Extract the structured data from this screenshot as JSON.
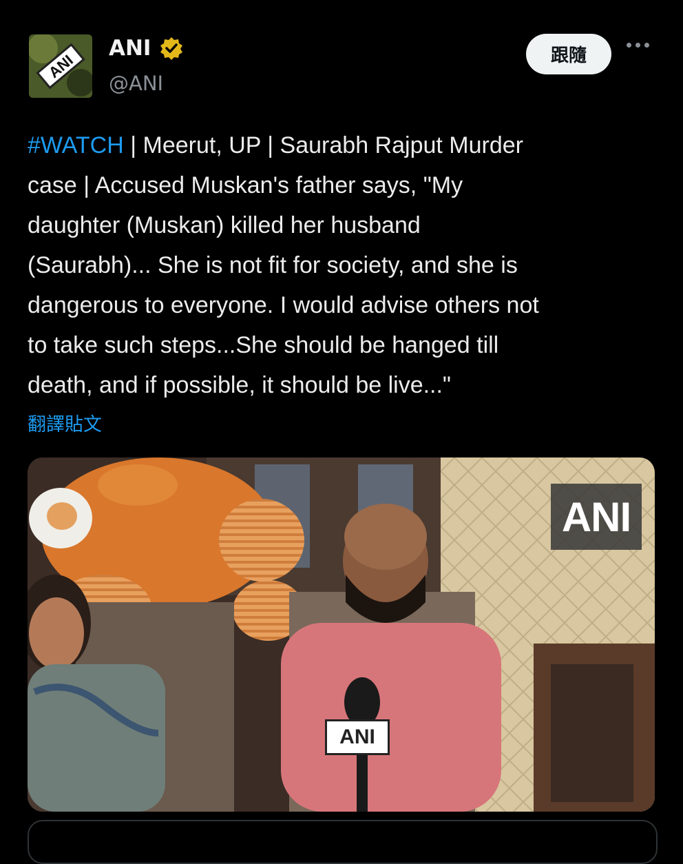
{
  "account": {
    "name": "ANI",
    "handle": "@ANI",
    "avatar_icon": "ani-logo-icon",
    "verified_badge": "verified-badge-icon",
    "verified_color": "#e2b719"
  },
  "actions": {
    "follow_label": "跟隨",
    "more_icon": "more-options-icon"
  },
  "post": {
    "hashtag": "#WATCH",
    "body": " | Meerut, UP | Saurabh Rajput Murder\ncase | Accused Muskan's father says, \"My\ndaughter (Muskan) killed her husband\n(Saurabh)... She is not fit for society, and she is\ndangerous to everyone. I would advise others not\nto take such steps...She should be hanged till\ndeath, and if possible, it should be live...\"",
    "translate_label": "翻譯貼文"
  },
  "media": {
    "watermark": "ANI",
    "mic_label": "ANI"
  },
  "colors": {
    "background": "#000000",
    "link": "#1d9bf0",
    "text": "#e7e9ea",
    "muted": "#8b9197"
  }
}
